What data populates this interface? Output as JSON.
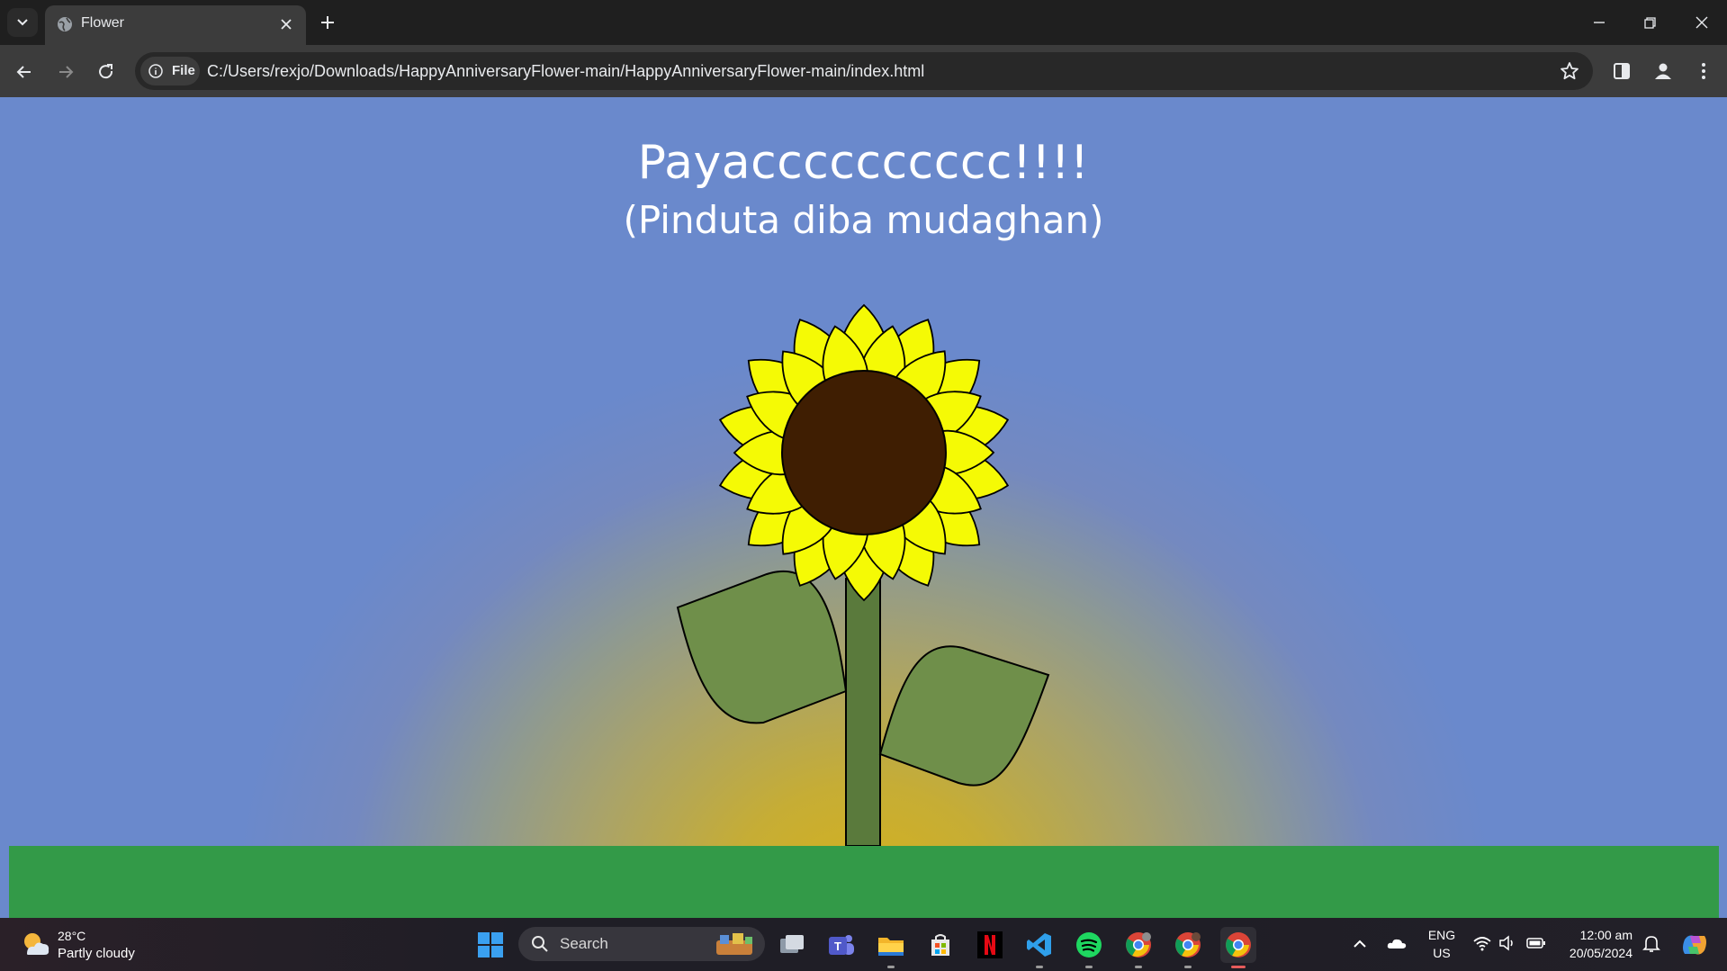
{
  "browser": {
    "tab": {
      "title": "Flower"
    },
    "address": {
      "scheme_chip": "File",
      "url": "C:/Users/rexjo/Downloads/HappyAnniversaryFlower-main/HappyAnniversaryFlower-main/index.html"
    }
  },
  "page": {
    "headline": "Payacccccccccc!!!!",
    "subheadline": "(Pinduta diba mudaghan)",
    "colors": {
      "sky": "#6a89cc",
      "sun_glow": "#d6b21b",
      "ground": "#339a48",
      "petal": "#f5fa05",
      "center": "#3f1e02",
      "stem": "#5a7a3c",
      "leaf": "#6f8f4a"
    }
  },
  "taskbar": {
    "weather": {
      "temp": "28°C",
      "desc": "Partly cloudy"
    },
    "search_label": "Search",
    "apps": [
      "start-icon",
      "task-view-icon",
      "teams-icon",
      "file-explorer-icon",
      "microsoft-store-icon",
      "netflix-icon",
      "vscode-icon",
      "spotify-icon",
      "chrome-profile-icon",
      "chrome-profile-icon",
      "chrome-icon"
    ],
    "tray": {
      "lang_top": "ENG",
      "lang_bottom": "US",
      "time": "12:00 am",
      "date": "20/05/2024"
    }
  }
}
